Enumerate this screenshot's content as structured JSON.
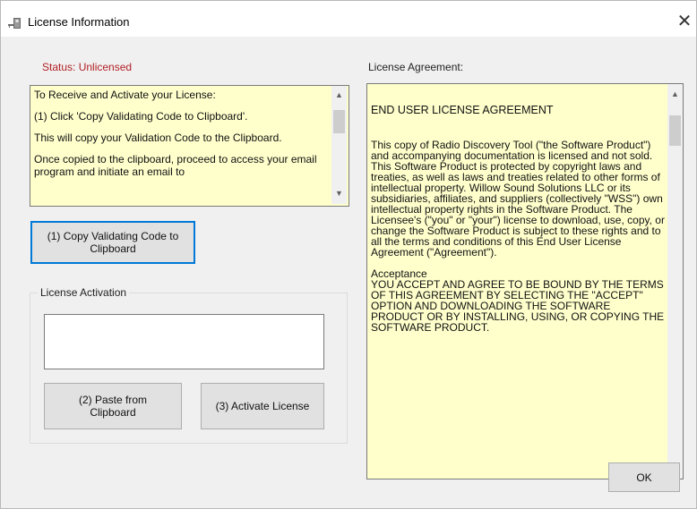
{
  "window": {
    "title": "License Information",
    "close_glyph": "✕"
  },
  "status": {
    "text": "Status: Unlicensed",
    "color": "#b21f24"
  },
  "instructions": {
    "lines": [
      "To Receive and Activate your License:",
      "(1) Click 'Copy Validating Code to Clipboard'.",
      "This will copy your Validation Code to the Clipboard.",
      "Once copied to the clipboard, proceed to access your email program and initiate an email to"
    ]
  },
  "buttons": {
    "copy_label": "(1) Copy Validating Code to Clipboard",
    "paste_label": "(2) Paste from Clipboard",
    "activate_label": "(3) Activate License",
    "ok_label": "OK"
  },
  "activation": {
    "group_label": "License Activation",
    "input_value": ""
  },
  "license": {
    "label": "License Agreement:",
    "heading": "END USER LICENSE AGREEMENT",
    "paragraph": "This copy of Radio Discovery Tool (\"the Software Product\") and accompanying documentation is licensed and not sold. This Software Product is protected by copyright laws and treaties, as well as laws and treaties related to other forms of intellectual property. Willow Sound Solutions LLC or its subsidiaries, affiliates, and suppliers (collectively \"WSS\") own intellectual property rights in the Software Product. The Licensee's (\"you\" or \"your\") license to download, use, copy, or change the Software Product is subject to these rights and to all the terms and conditions of this End User License Agreement (\"Agreement\").",
    "acceptance_heading": "Acceptance",
    "acceptance_text": "YOU ACCEPT AND AGREE TO BE BOUND BY THE TERMS OF THIS AGREEMENT BY SELECTING THE \"ACCEPT\" OPTION AND DOWNLOADING THE SOFTWARE PRODUCT OR BY INSTALLING, USING, OR COPYING THE SOFTWARE PRODUCT."
  },
  "icons": {
    "window_icon": "license-key-icon",
    "scroll_up": "chevron-up-icon",
    "scroll_down": "chevron-down-icon"
  }
}
